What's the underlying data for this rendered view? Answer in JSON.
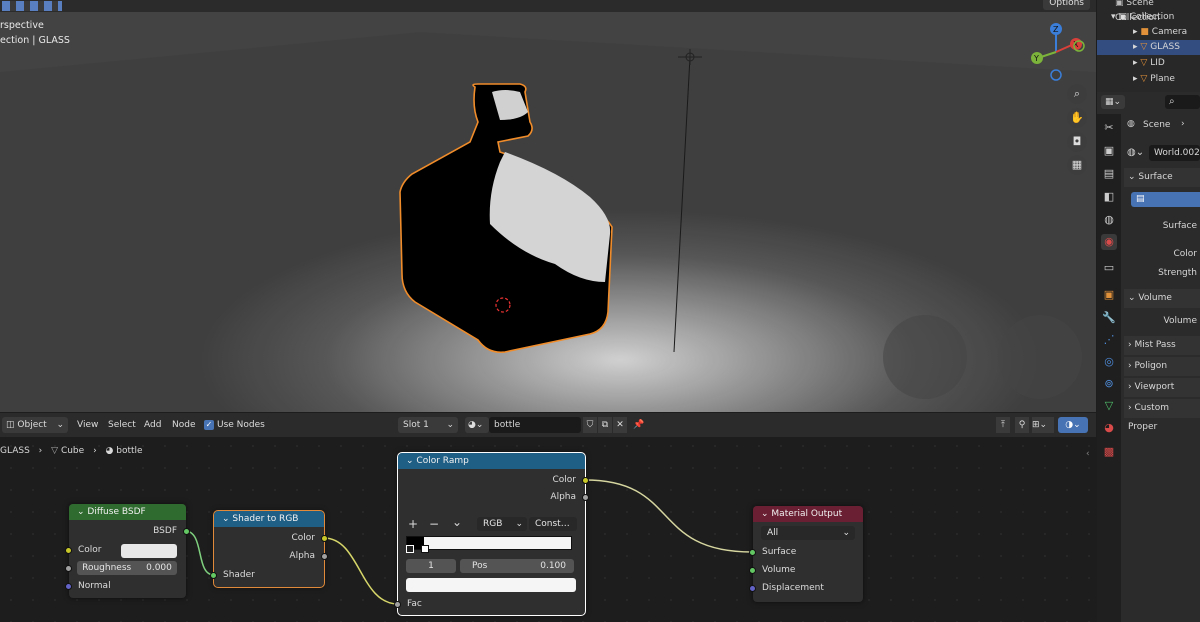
{
  "viewport": {
    "mode_line": "rspective",
    "collection_line": "ection | GLASS",
    "options_label": "Options",
    "gizmo_axes": {
      "z": "Z",
      "x": "X",
      "y": "Y"
    }
  },
  "outliner": {
    "rows": [
      {
        "label": "Scene Collection",
        "icon": "collection-icon"
      },
      {
        "label": "Collection",
        "icon": "collection-icon"
      },
      {
        "label": "Camera",
        "icon": "camera-icon"
      },
      {
        "label": "GLASS",
        "icon": "mesh-icon"
      },
      {
        "label": "LID",
        "icon": "mesh-icon"
      },
      {
        "label": "Plane",
        "icon": "mesh-icon"
      }
    ]
  },
  "properties": {
    "scene_label": "Scene",
    "world_name": "World.002",
    "sections": {
      "surface": "Surface",
      "surface_field": "Surface",
      "color": "Color",
      "strength": "Strength",
      "volume": "Volume",
      "volume_field": "Volume",
      "mist": "Mist Pass",
      "poligon": "Poligon",
      "viewport_display": "Viewport Displa",
      "custom_props": "Custom Proper"
    }
  },
  "node_header": {
    "mode": "Object",
    "menu": [
      "View",
      "Select",
      "Add",
      "Node"
    ],
    "use_nodes_label": "Use Nodes",
    "slot": "Slot 1",
    "material": "bottle"
  },
  "breadcrumb": {
    "object": "GLASS",
    "mesh": "Cube",
    "material": "bottle"
  },
  "nodes": {
    "diffuse": {
      "title": "Diffuse BSDF",
      "out": "BSDF",
      "color_label": "Color",
      "roughness_label": "Roughness",
      "roughness_value": "0.000",
      "normal_label": "Normal"
    },
    "shader_to_rgb": {
      "title": "Shader to RGB",
      "out_color": "Color",
      "out_alpha": "Alpha",
      "in_shader": "Shader"
    },
    "color_ramp": {
      "title": "Color Ramp",
      "out_color": "Color",
      "out_alpha": "Alpha",
      "mode": "RGB",
      "interp": "Const…",
      "stop_index": "1",
      "pos_label": "Pos",
      "pos_value": "0.100",
      "in_fac": "Fac",
      "add": "+",
      "remove": "−",
      "menu": "⌄"
    },
    "output": {
      "title": "Material Output",
      "target": "All",
      "in_surface": "Surface",
      "in_volume": "Volume",
      "in_displacement": "Displacement"
    }
  },
  "colors": {
    "diffuse_header": "#2f6a2f",
    "converter_header": "#1f5f86",
    "output_header": "#6b1f33",
    "selection_blue": "#334d80",
    "active_outline": "#e08a3a"
  }
}
